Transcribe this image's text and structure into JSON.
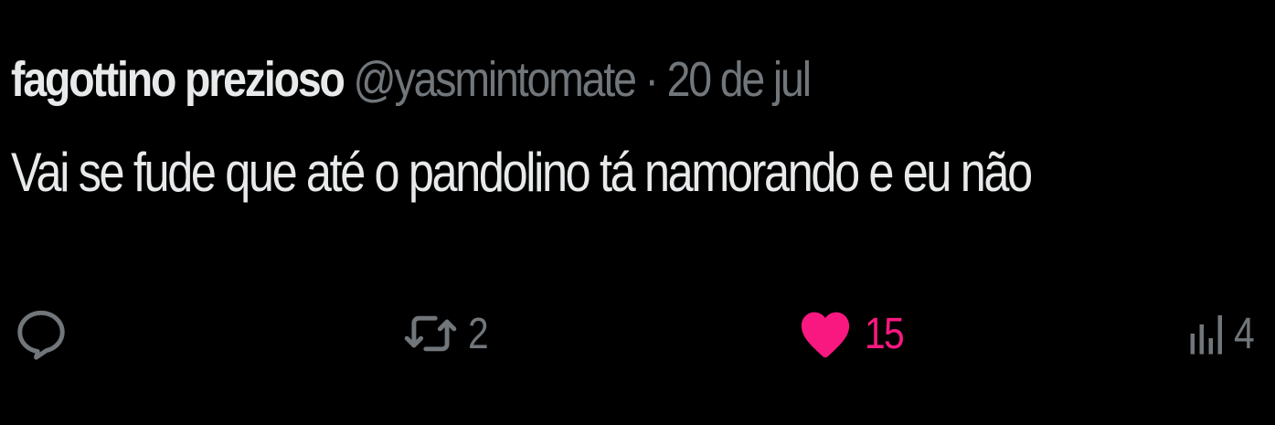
{
  "tweet": {
    "display_name": "fagottino prezioso",
    "handle": "@yasmintomate",
    "separator": "·",
    "date": "20 de jul",
    "text": "Vai se fude que até o pandolino tá namorando e eu não"
  },
  "actions": {
    "reply": {
      "icon": "reply-icon"
    },
    "retweet": {
      "icon": "retweet-icon",
      "count": "2"
    },
    "like": {
      "icon": "heart-icon",
      "count": "15",
      "liked": true,
      "color": "#f91880"
    },
    "views": {
      "icon": "views-icon",
      "count": "4"
    }
  },
  "colors": {
    "background": "#000000",
    "primary_text": "#e7e9ea",
    "secondary_text": "#71767b",
    "like_accent": "#f91880"
  }
}
